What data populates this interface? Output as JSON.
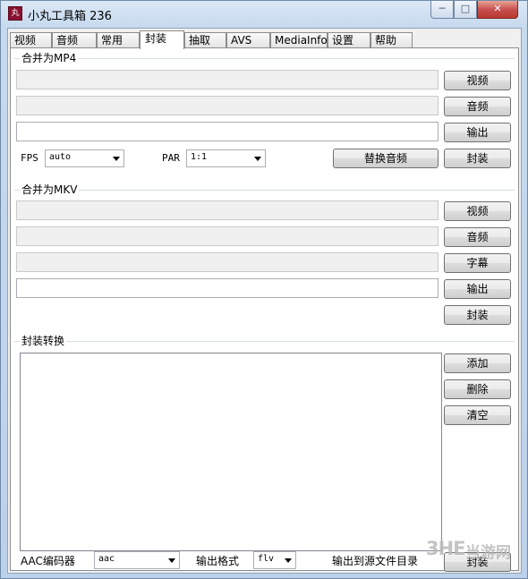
{
  "window": {
    "icon_text": "丸",
    "title": "小丸工具箱 236",
    "minimize": "─",
    "maximize": "□",
    "close": "✕"
  },
  "tabs": [
    "视频",
    "音频",
    "常用",
    "封装",
    "抽取",
    "AVS",
    "MediaInfo",
    "设置",
    "帮助"
  ],
  "active_tab": "封装",
  "mp4": {
    "title": "合并为MP4",
    "video_btn": "视频",
    "audio_btn": "音频",
    "output_btn": "输出",
    "fps_label": "FPS",
    "fps_value": "auto",
    "par_label": "PAR",
    "par_value": "1:1",
    "replace_audio_btn": "替换音频",
    "mux_btn": "封装"
  },
  "mkv": {
    "title": "合并为MKV",
    "video_btn": "视频",
    "audio_btn": "音频",
    "subtitle_btn": "字幕",
    "output_btn": "输出",
    "mux_btn": "封装"
  },
  "convert": {
    "title": "封装转换",
    "add_btn": "添加",
    "delete_btn": "删除",
    "clear_btn": "清空",
    "aac_label": "AAC编码器",
    "aac_value": "aac",
    "format_label": "输出格式",
    "format_value": "flv",
    "output_to_source": "输出到源文件目录",
    "mux_btn": "封装"
  },
  "watermark": {
    "logo": "3HE",
    "text": "当游网"
  }
}
